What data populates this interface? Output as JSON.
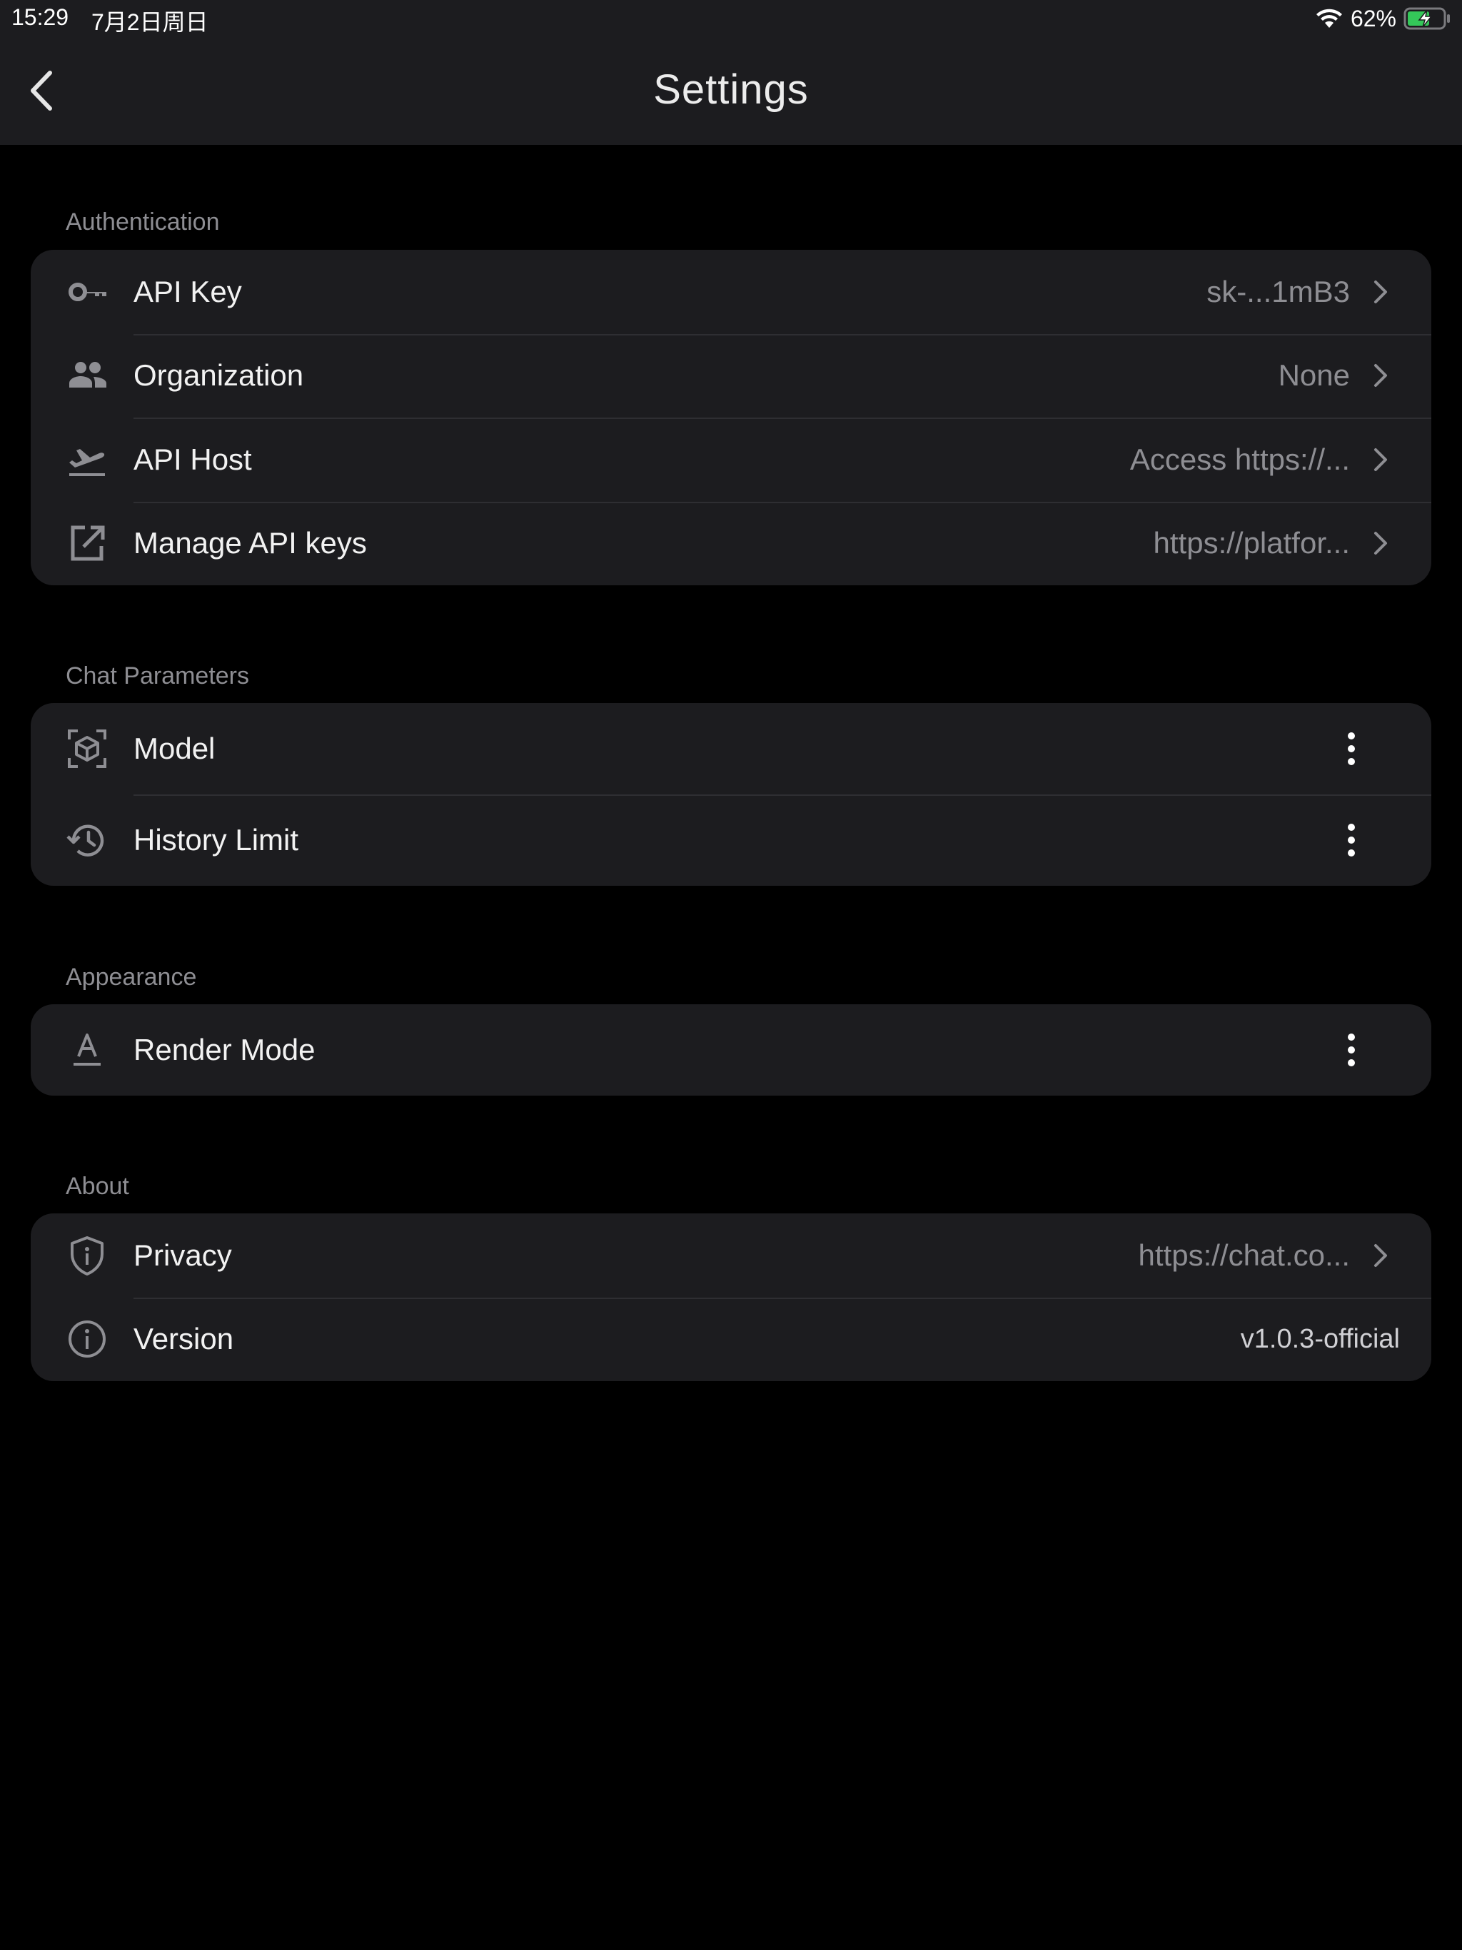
{
  "status_bar": {
    "time": "15:29",
    "date": "7月2日周日",
    "battery_percent": "62%",
    "battery_level": 0.62
  },
  "nav": {
    "title": "Settings",
    "back_icon": "chevron-left-icon"
  },
  "sections": {
    "authentication": {
      "label": "Authentication",
      "rows": [
        {
          "icon": "key-icon",
          "label": "API Key",
          "value": "sk-...1mB3"
        },
        {
          "icon": "people-icon",
          "label": "Organization",
          "value": "None"
        },
        {
          "icon": "flight-takeoff-icon",
          "label": "API Host",
          "value": "Access https://..."
        },
        {
          "icon": "open-external-icon",
          "label": "Manage API keys",
          "value": "https://platfor..."
        }
      ]
    },
    "chat_parameters": {
      "label": "Chat Parameters",
      "rows": [
        {
          "icon": "cube-scan-icon",
          "label": "Model"
        },
        {
          "icon": "history-icon",
          "label": "History Limit"
        }
      ]
    },
    "appearance": {
      "label": "Appearance",
      "rows": [
        {
          "icon": "text-format-icon",
          "label": "Render Mode"
        }
      ]
    },
    "about": {
      "label": "About",
      "rows": [
        {
          "icon": "shield-icon",
          "label": "Privacy",
          "value": "https://chat.co..."
        },
        {
          "icon": "info-icon",
          "label": "Version",
          "value": "v1.0.3-official"
        }
      ]
    }
  },
  "colors": {
    "background": "#000000",
    "surface": "#1c1c1f",
    "secondary_text": "#8e8e93",
    "battery_green": "#34c759"
  }
}
